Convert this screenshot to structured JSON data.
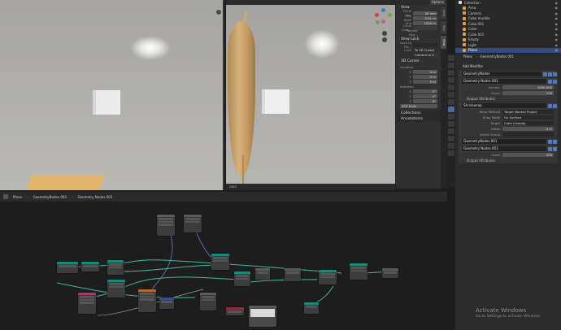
{
  "options_label": "Options",
  "npanel": {
    "view_header": "View",
    "focal_label": "Focal Len.",
    "focal_value": "50 mm",
    "clip_start_label": "Clip Start",
    "clip_start_value": "0.01 m",
    "clip_end_label": "End",
    "clip_end_value": "1000 m",
    "local_camera_label": "Local Cam...",
    "render_region_label": "Render Reg...",
    "view_lock_header": "View Lock",
    "lock_to_obj_label": "Lock to Ob...",
    "lock_label": "Lock",
    "lock_3dcursor": "To 3D Cursor",
    "camera_to_view": "Camera to V...",
    "cursor_header": "3D Cursor",
    "location_label": "Location:",
    "x_label": "X",
    "x_value": "0 m",
    "y_label": "Y",
    "y_value": "0 m",
    "z_label": "Z",
    "z_value": "0 m",
    "rotation_label": "Rotation:",
    "rx_value": "0°",
    "ry_value": "0°",
    "rz_value": "0°",
    "euler_value": "XYZ Euler",
    "collections_header": "Collections",
    "annotations_header": "Annotations",
    "tabs": [
      "Item",
      "Tool",
      "View"
    ]
  },
  "outliner": {
    "items": [
      {
        "label": "Collection",
        "color": "#c9c9c9"
      },
      {
        "label": "Area",
        "color": "#e0a040"
      },
      {
        "label": "Camera",
        "color": "#e0a040"
      },
      {
        "label": "Cubo mueble",
        "color": "#e0a040"
      },
      {
        "label": "Cubo.001",
        "color": "#e0a040"
      },
      {
        "label": "Cube",
        "color": "#e0a040"
      },
      {
        "label": "Cube.001",
        "color": "#e0a040"
      },
      {
        "label": "Empty",
        "color": "#e0a040"
      },
      {
        "label": "Light",
        "color": "#e0a040"
      },
      {
        "label": "Plane",
        "color": "#e0a040"
      }
    ]
  },
  "props": {
    "breadcrumb_obj": "Plane",
    "breadcrumb_mod": "GeometryNodes.001",
    "add_modifier": "Add Modifier",
    "mod1_name": "GeometryNodes",
    "mod2_name": "Geometry Nodes.001",
    "density_label": "Density",
    "density_value": "1000.000",
    "count_label": "Count",
    "count_value": "126",
    "output_attributes": "Output Attributes",
    "shrinkwrap_name": "Shrinkwrap",
    "wrap_method_label": "Wrap Method",
    "wrap_method_value": "Target Normal Project",
    "snap_mode_label": "Snap Mode",
    "snap_mode_value": "On Surface",
    "target_label": "Target",
    "target_value": "Cubo (simple)",
    "offset_label": "Offset",
    "offset_value": "0 m",
    "vertex_group_label": "Vertex Group",
    "mod3_name": "GeometryNodes.001",
    "mod4_name": "Geometry Nodes.003",
    "count2_label": "Count",
    "count2_value": "256",
    "output_attributes2": "Output Attributes"
  },
  "node_editor": {
    "crumb_obj": "Plane",
    "crumb_mod": "GeometryNodes.003",
    "crumb_tree": "Geometry Nodes.003"
  },
  "activate": {
    "title": "Activate Windows",
    "subtitle": "Go to Settings to activate Windows."
  }
}
